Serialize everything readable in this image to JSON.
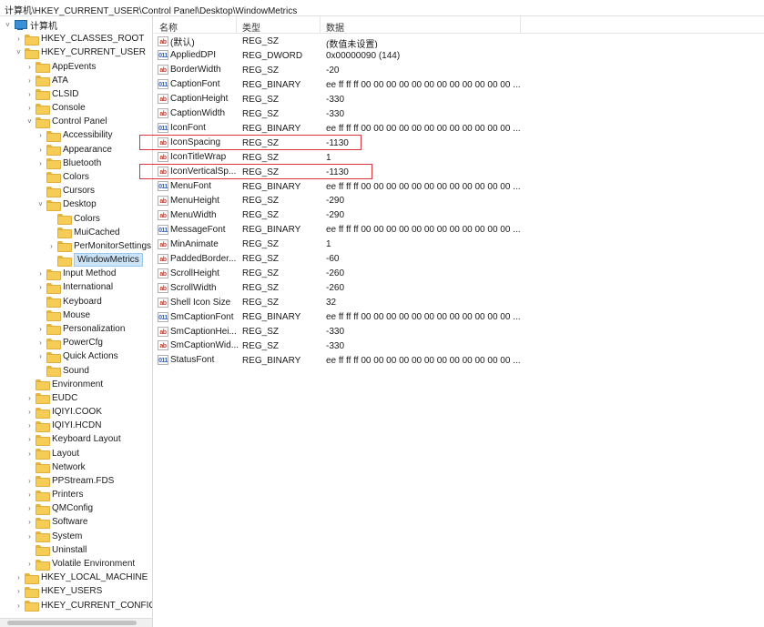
{
  "address": "计算机\\HKEY_CURRENT_USER\\Control Panel\\Desktop\\WindowMetrics",
  "tree": [
    {
      "label": "计算机",
      "depth": 0,
      "exp": "v",
      "icon": "computer-icon"
    },
    {
      "label": "HKEY_CLASSES_ROOT",
      "depth": 1,
      "exp": ">",
      "icon": "folder-icon"
    },
    {
      "label": "HKEY_CURRENT_USER",
      "depth": 1,
      "exp": "v",
      "icon": "folder-icon"
    },
    {
      "label": "AppEvents",
      "depth": 2,
      "exp": ">",
      "icon": "folder-icon"
    },
    {
      "label": "ATA",
      "depth": 2,
      "exp": ">",
      "icon": "folder-icon"
    },
    {
      "label": "CLSID",
      "depth": 2,
      "exp": ">",
      "icon": "folder-icon"
    },
    {
      "label": "Console",
      "depth": 2,
      "exp": ">",
      "icon": "folder-icon"
    },
    {
      "label": "Control Panel",
      "depth": 2,
      "exp": "v",
      "icon": "folder-icon"
    },
    {
      "label": "Accessibility",
      "depth": 3,
      "exp": ">",
      "icon": "folder-icon"
    },
    {
      "label": "Appearance",
      "depth": 3,
      "exp": ">",
      "icon": "folder-icon"
    },
    {
      "label": "Bluetooth",
      "depth": 3,
      "exp": ">",
      "icon": "folder-icon"
    },
    {
      "label": "Colors",
      "depth": 3,
      "exp": "",
      "icon": "folder-icon"
    },
    {
      "label": "Cursors",
      "depth": 3,
      "exp": "",
      "icon": "folder-icon"
    },
    {
      "label": "Desktop",
      "depth": 3,
      "exp": "v",
      "icon": "folder-icon"
    },
    {
      "label": "Colors",
      "depth": 4,
      "exp": "",
      "icon": "folder-icon"
    },
    {
      "label": "MuiCached",
      "depth": 4,
      "exp": "",
      "icon": "folder-icon"
    },
    {
      "label": "PerMonitorSettings",
      "depth": 4,
      "exp": ">",
      "icon": "folder-icon"
    },
    {
      "label": "WindowMetrics",
      "depth": 4,
      "exp": "",
      "icon": "folder-icon",
      "selected": true
    },
    {
      "label": "Input Method",
      "depth": 3,
      "exp": ">",
      "icon": "folder-icon"
    },
    {
      "label": "International",
      "depth": 3,
      "exp": ">",
      "icon": "folder-icon"
    },
    {
      "label": "Keyboard",
      "depth": 3,
      "exp": "",
      "icon": "folder-icon"
    },
    {
      "label": "Mouse",
      "depth": 3,
      "exp": "",
      "icon": "folder-icon"
    },
    {
      "label": "Personalization",
      "depth": 3,
      "exp": ">",
      "icon": "folder-icon"
    },
    {
      "label": "PowerCfg",
      "depth": 3,
      "exp": ">",
      "icon": "folder-icon"
    },
    {
      "label": "Quick Actions",
      "depth": 3,
      "exp": ">",
      "icon": "folder-icon"
    },
    {
      "label": "Sound",
      "depth": 3,
      "exp": "",
      "icon": "folder-icon"
    },
    {
      "label": "Environment",
      "depth": 2,
      "exp": "",
      "icon": "folder-icon"
    },
    {
      "label": "EUDC",
      "depth": 2,
      "exp": ">",
      "icon": "folder-icon"
    },
    {
      "label": "IQIYI.COOK",
      "depth": 2,
      "exp": ">",
      "icon": "folder-icon"
    },
    {
      "label": "IQIYI.HCDN",
      "depth": 2,
      "exp": ">",
      "icon": "folder-icon"
    },
    {
      "label": "Keyboard Layout",
      "depth": 2,
      "exp": ">",
      "icon": "folder-icon"
    },
    {
      "label": "Layout",
      "depth": 2,
      "exp": ">",
      "icon": "folder-icon"
    },
    {
      "label": "Network",
      "depth": 2,
      "exp": "",
      "icon": "folder-icon"
    },
    {
      "label": "PPStream.FDS",
      "depth": 2,
      "exp": ">",
      "icon": "folder-icon"
    },
    {
      "label": "Printers",
      "depth": 2,
      "exp": ">",
      "icon": "folder-icon"
    },
    {
      "label": "QMConfig",
      "depth": 2,
      "exp": ">",
      "icon": "folder-icon"
    },
    {
      "label": "Software",
      "depth": 2,
      "exp": ">",
      "icon": "folder-icon"
    },
    {
      "label": "System",
      "depth": 2,
      "exp": ">",
      "icon": "folder-icon"
    },
    {
      "label": "Uninstall",
      "depth": 2,
      "exp": "",
      "icon": "folder-icon"
    },
    {
      "label": "Volatile Environment",
      "depth": 2,
      "exp": ">",
      "icon": "folder-icon"
    },
    {
      "label": "HKEY_LOCAL_MACHINE",
      "depth": 1,
      "exp": ">",
      "icon": "folder-icon"
    },
    {
      "label": "HKEY_USERS",
      "depth": 1,
      "exp": ">",
      "icon": "folder-icon"
    },
    {
      "label": "HKEY_CURRENT_CONFIG",
      "depth": 1,
      "exp": ">",
      "icon": "folder-icon"
    }
  ],
  "columns": {
    "name": "名称",
    "type": "类型",
    "data": "数据"
  },
  "values": [
    {
      "name": "(默认)",
      "type": "REG_SZ",
      "data": "(数值未设置)",
      "kind": "sz"
    },
    {
      "name": "AppliedDPI",
      "type": "REG_DWORD",
      "data": "0x00000090 (144)",
      "kind": "bin"
    },
    {
      "name": "BorderWidth",
      "type": "REG_SZ",
      "data": "-20",
      "kind": "sz"
    },
    {
      "name": "CaptionFont",
      "type": "REG_BINARY",
      "data": "ee ff ff ff 00 00 00 00 00 00 00 00 00 00 00 00 ...",
      "kind": "bin"
    },
    {
      "name": "CaptionHeight",
      "type": "REG_SZ",
      "data": "-330",
      "kind": "sz"
    },
    {
      "name": "CaptionWidth",
      "type": "REG_SZ",
      "data": "-330",
      "kind": "sz"
    },
    {
      "name": "IconFont",
      "type": "REG_BINARY",
      "data": "ee ff ff ff 00 00 00 00 00 00 00 00 00 00 00 00 ...",
      "kind": "bin"
    },
    {
      "name": "IconSpacing",
      "type": "REG_SZ",
      "data": "-1130",
      "kind": "sz"
    },
    {
      "name": "IconTitleWrap",
      "type": "REG_SZ",
      "data": "1",
      "kind": "sz"
    },
    {
      "name": "IconVerticalSp...",
      "type": "REG_SZ",
      "data": "-1130",
      "kind": "sz"
    },
    {
      "name": "MenuFont",
      "type": "REG_BINARY",
      "data": "ee ff ff ff 00 00 00 00 00 00 00 00 00 00 00 00 ...",
      "kind": "bin"
    },
    {
      "name": "MenuHeight",
      "type": "REG_SZ",
      "data": "-290",
      "kind": "sz"
    },
    {
      "name": "MenuWidth",
      "type": "REG_SZ",
      "data": "-290",
      "kind": "sz"
    },
    {
      "name": "MessageFont",
      "type": "REG_BINARY",
      "data": "ee ff ff ff 00 00 00 00 00 00 00 00 00 00 00 00 ...",
      "kind": "bin"
    },
    {
      "name": "MinAnimate",
      "type": "REG_SZ",
      "data": "1",
      "kind": "sz"
    },
    {
      "name": "PaddedBorder...",
      "type": "REG_SZ",
      "data": "-60",
      "kind": "sz"
    },
    {
      "name": "ScrollHeight",
      "type": "REG_SZ",
      "data": "-260",
      "kind": "sz"
    },
    {
      "name": "ScrollWidth",
      "type": "REG_SZ",
      "data": "-260",
      "kind": "sz"
    },
    {
      "name": "Shell Icon Size",
      "type": "REG_SZ",
      "data": "32",
      "kind": "sz"
    },
    {
      "name": "SmCaptionFont",
      "type": "REG_BINARY",
      "data": "ee ff ff ff 00 00 00 00 00 00 00 00 00 00 00 00 ...",
      "kind": "bin"
    },
    {
      "name": "SmCaptionHei...",
      "type": "REG_SZ",
      "data": "-330",
      "kind": "sz"
    },
    {
      "name": "SmCaptionWid...",
      "type": "REG_SZ",
      "data": "-330",
      "kind": "sz"
    },
    {
      "name": "StatusFont",
      "type": "REG_BINARY",
      "data": "ee ff ff ff 00 00 00 00 00 00 00 00 00 00 00 00 ...",
      "kind": "bin"
    }
  ],
  "highlighted_rows": [
    "IconSpacing",
    "IconVerticalSp..."
  ],
  "colors": {
    "highlight_box": "#d9373d",
    "selection": "#cce4f7"
  }
}
